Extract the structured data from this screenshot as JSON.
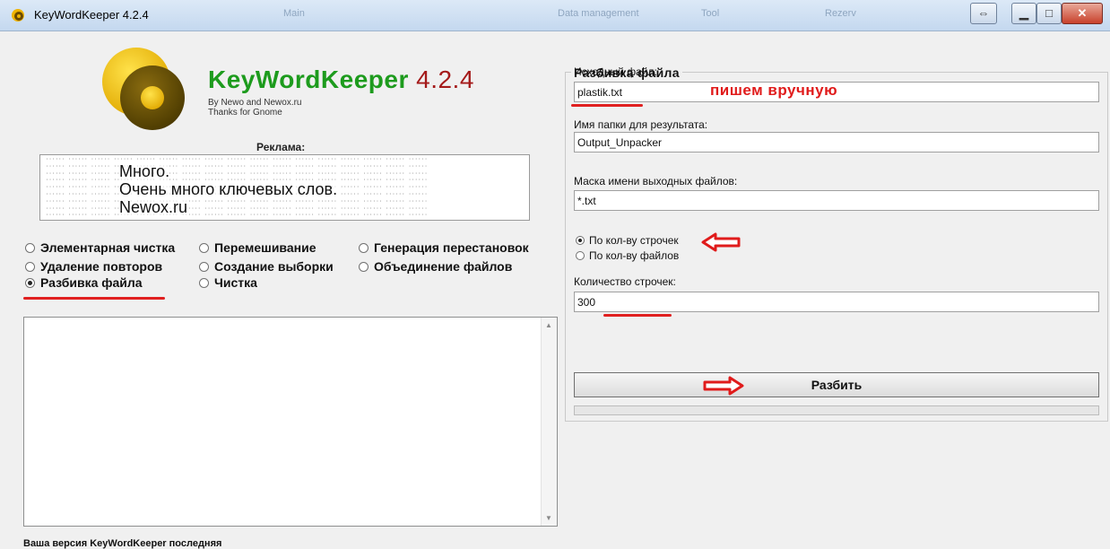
{
  "window": {
    "title": "KeyWordKeeper 4.2.4",
    "ghost_titles": [
      "Main",
      "Data management",
      "Tool",
      "Rezerv"
    ]
  },
  "brand": {
    "name_part1": "Key",
    "name_part2": "Word",
    "name_part3": "Keeper",
    "version": "4.2.4",
    "by": "By Newo and Newox.ru",
    "thanks": "Thanks for Gnome"
  },
  "ad": {
    "label": "Реклама:",
    "line1": "Много.",
    "line2": "Очень много ключевых слов.",
    "line3": "Newox.ru"
  },
  "modes": {
    "elementary": "Элементарная чистка",
    "shuffle": "Перемешивание",
    "permutations": "Генерация перестановок",
    "dedupe": "Удаление повторов",
    "sample": "Создание выборки",
    "merge": "Объединение файлов",
    "split": "Разбивка файла",
    "clean": "Чистка",
    "selected": "split"
  },
  "status": "Ваша версия KeyWordKeeper последняя",
  "panel": {
    "title": "Разбивка файла",
    "source_label": "Исходный файл:",
    "source_value": "plastik.txt",
    "folder_label": "Имя папки для результата:",
    "folder_value": "Output_Unpacker",
    "mask_label": "Маска имени выходных файлов:",
    "mask_value": "*.txt",
    "by_lines": "По кол-ву строчек",
    "by_files": "По кол-ву файлов",
    "count_label": "Количество строчек:",
    "count_value": "300",
    "button": "Разбить",
    "progress_fraction": 0
  },
  "annotation": {
    "manual": "пишем вручную"
  },
  "colors": {
    "annotation_red": "#e01b1b",
    "brand_green": "#1d9b1d",
    "version_red": "#a41a1a"
  }
}
